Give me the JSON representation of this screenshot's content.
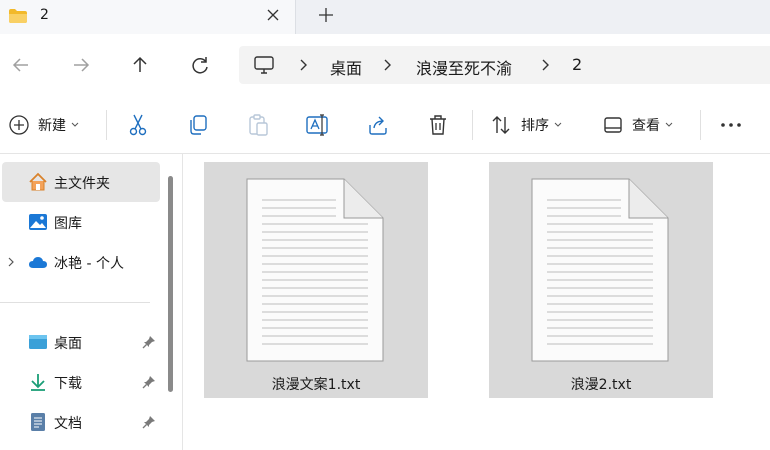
{
  "tab": {
    "title": "2"
  },
  "breadcrumb": [
    "桌面",
    "浪漫至死不渝",
    "2"
  ],
  "toolbar": {
    "new_label": "新建",
    "sort_label": "排序",
    "view_label": "查看",
    "more_label": "···"
  },
  "sidebar": {
    "items": [
      {
        "label": "主文件夹"
      },
      {
        "label": "图库"
      },
      {
        "label": "冰艳 - 个人"
      },
      {
        "label": "桌面"
      },
      {
        "label": "下载"
      },
      {
        "label": "文档"
      }
    ]
  },
  "files": [
    {
      "name": "浪漫文案1.txt"
    },
    {
      "name": "浪漫2.txt"
    }
  ],
  "colors": {
    "accent": "#0067c0",
    "home_icon": "#d9822b",
    "onedrive": "#1b78d6",
    "selection": "#d9d9d9"
  }
}
